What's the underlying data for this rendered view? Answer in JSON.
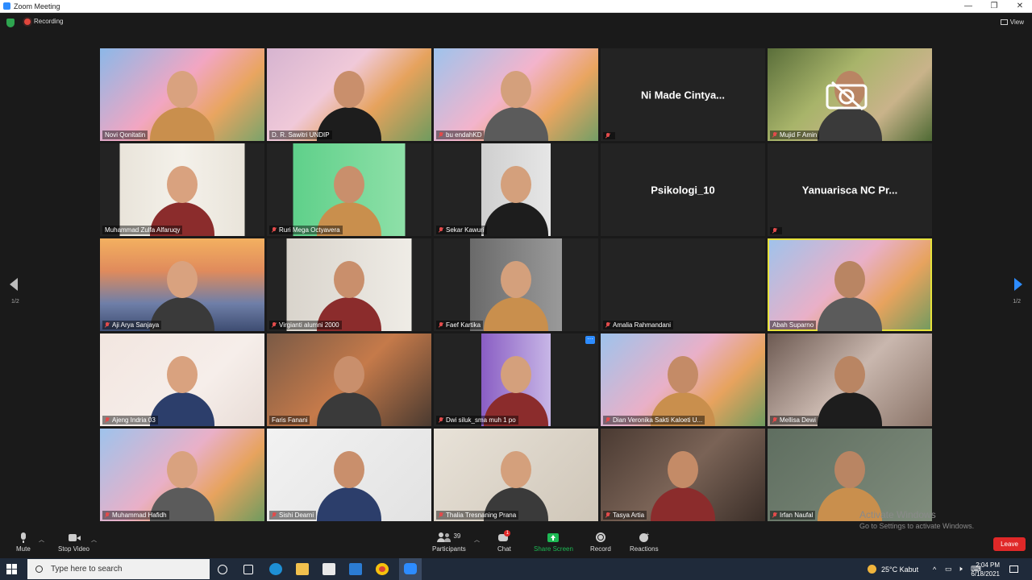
{
  "window": {
    "title": "Zoom Meeting",
    "minimize": "—",
    "restore": "❐",
    "close": "✕"
  },
  "topbar": {
    "recording": "Recording",
    "view": "View"
  },
  "pagination": {
    "left": "1/2",
    "right": "1/2"
  },
  "tiles": [
    {
      "name": "Novi Qonitatin",
      "video": true,
      "muted": false
    },
    {
      "name": "D. R. Sawitri UNDIP",
      "video": true,
      "muted": false
    },
    {
      "name": "bu endahKD",
      "video": true,
      "muted": true
    },
    {
      "name": "",
      "display": "Ni Made Cintya...",
      "video": false,
      "muted": true
    },
    {
      "name": "Mujid F Amin",
      "video": true,
      "muted": true,
      "camera_off_overlay": true
    },
    {
      "name": "Muhammad Zulfa Alfaruqy",
      "video": true,
      "muted": false
    },
    {
      "name": "Ruri Mega Octyavera",
      "video": true,
      "muted": true
    },
    {
      "name": "Sekar Kawuri",
      "video": true,
      "muted": true
    },
    {
      "name": "",
      "display": "Psikologi_10",
      "video": false,
      "muted": false
    },
    {
      "name": "",
      "display": "Yanuarisca NC Pr...",
      "video": false,
      "muted": true
    },
    {
      "name": "Aji Arya Sanjaya",
      "video": true,
      "muted": true
    },
    {
      "name": "Virgianti alumni 2000",
      "video": true,
      "muted": true
    },
    {
      "name": "Faef Kartika",
      "video": true,
      "muted": true
    },
    {
      "name": "Amalia Rahmandani",
      "video": false,
      "muted": true
    },
    {
      "name": "Abah Suparno",
      "video": true,
      "muted": false,
      "active_speaker": true
    },
    {
      "name": "Ajeng Indria 03",
      "video": true,
      "muted": true
    },
    {
      "name": "Faris Fanani",
      "video": true,
      "muted": false
    },
    {
      "name": "Dwi siluk_sma muh 1 po",
      "video": true,
      "muted": true,
      "more_button": "···"
    },
    {
      "name": "Dian Veronika Sakti Kaloeti U...",
      "video": true,
      "muted": true
    },
    {
      "name": "Mellisa Dewi",
      "video": true,
      "muted": true
    },
    {
      "name": "Muhammad Hafidh",
      "video": true,
      "muted": true
    },
    {
      "name": "Sishi Dearni",
      "video": true,
      "muted": true
    },
    {
      "name": "Thalia Tresnaning Prana",
      "video": true,
      "muted": true
    },
    {
      "name": "Tasya Artia",
      "video": true,
      "muted": true
    },
    {
      "name": "Irfan Naufal",
      "video": true,
      "muted": true
    }
  ],
  "toolbar": {
    "mute": "Mute",
    "stop_video": "Stop Video",
    "participants": "Participants",
    "participants_count": "39",
    "chat": "Chat",
    "chat_badge": "1",
    "share_screen": "Share Screen",
    "record": "Record",
    "reactions": "Reactions",
    "leave": "Leave"
  },
  "watermark": {
    "line1": "Activate Windows",
    "line2": "Go to Settings to activate Windows."
  },
  "taskbar": {
    "search_placeholder": "Type here to search",
    "weather": "25°C  Kabut",
    "time": "2:04 PM",
    "date": "6/18/2021"
  },
  "colors": {
    "accent": "#2d8cff",
    "leave": "#e02828",
    "share": "#1db954",
    "active_border": "#e6e23b"
  }
}
